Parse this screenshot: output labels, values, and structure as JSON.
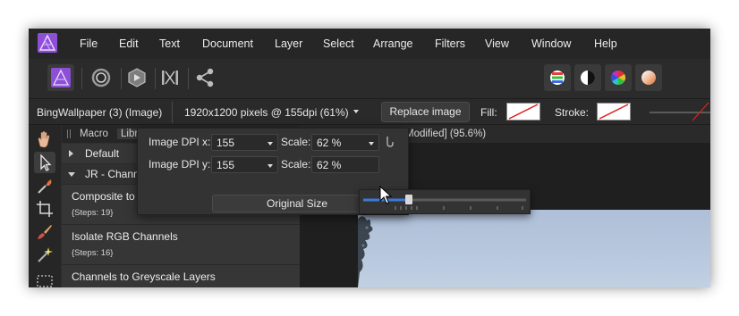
{
  "menu": {
    "items": [
      "File",
      "Edit",
      "Text",
      "Document",
      "Layer",
      "Select",
      "Arrange",
      "Filters",
      "View",
      "Window",
      "Help"
    ]
  },
  "toolbar": {
    "personas": [
      "photo-persona-icon",
      "liquify-persona-icon",
      "develop-persona-icon",
      "tone-mapping-persona-icon",
      "export-persona-icon"
    ],
    "adjustments": [
      "levels-icon",
      "black-white-icon",
      "hsl-icon",
      "white-balance-icon"
    ]
  },
  "context": {
    "layer_name": "BingWallpaper (3) (Image)",
    "dimensions": "1920x1200 pixels @ 155dpi (61%)",
    "replace_label": "Replace image",
    "fill_label": "Fill:",
    "stroke_label": "Stroke:"
  },
  "panel": {
    "tab_macro": "Macro",
    "tab_library": "Libr",
    "category_default": "Default",
    "category_jr": "JR - Chann",
    "macros": [
      {
        "title": "Composite to",
        "steps": "{Steps: 19}"
      },
      {
        "title": "Isolate RGB Channels",
        "steps": "{Steps: 16}"
      },
      {
        "title": "Channels to Greyscale Layers",
        "steps": ""
      }
    ]
  },
  "document": {
    "tab_title": "Modified] (95.6%)"
  },
  "dpi_popup": {
    "dpi_x_label": "Image DPI x:",
    "dpi_x_value": "155",
    "dpi_y_label": "Image DPI y:",
    "dpi_y_value": "155",
    "scale_label": "Scale:",
    "scale_x_value": "62 %",
    "scale_y_value": "62 %",
    "original_size_label": "Original Size"
  },
  "colors": {
    "accent": "#7a3fc2",
    "swatch_slash": "#e02020"
  }
}
